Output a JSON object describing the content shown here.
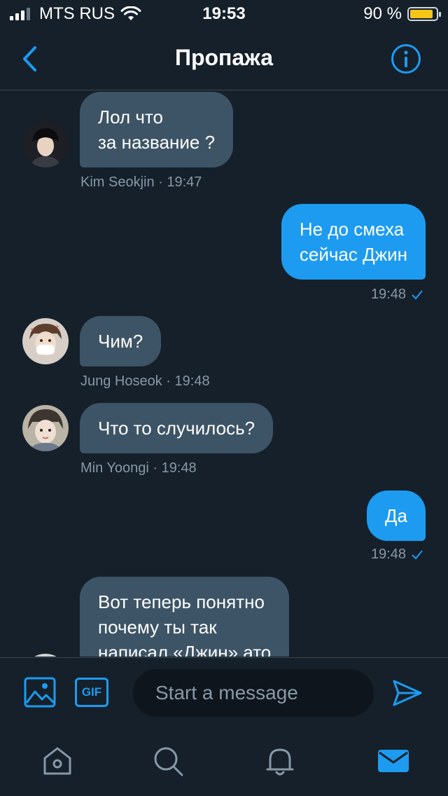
{
  "status_bar": {
    "carrier": "MTS RUS",
    "time": "19:53",
    "battery": "90 %",
    "battery_level": 0.9
  },
  "header": {
    "title": "Пропажа"
  },
  "messages": [
    {
      "direction": "in",
      "lines": [
        "Лол что",
        "за название ?"
      ],
      "meta": "Kim Seokjin · 19:47"
    },
    {
      "direction": "out",
      "lines": [
        "Не до смеха",
        "сейчас Джин"
      ],
      "time": "19:48"
    },
    {
      "direction": "in",
      "lines": [
        "Чим?"
      ],
      "meta": "Jung Hoseok · 19:48"
    },
    {
      "direction": "in",
      "lines": [
        "Что то случилось?"
      ],
      "meta": "Min Yoongi · 19:48"
    },
    {
      "direction": "out",
      "lines": [
        "Да"
      ],
      "time": "19:48"
    },
    {
      "direction": "in",
      "lines": [
        "Вот теперь понятно",
        "почему ты так",
        "написал «Джин» ато"
      ]
    }
  ],
  "composer": {
    "gif_label": "GIF",
    "placeholder": "Start a message"
  },
  "colors": {
    "background": "#15202b",
    "incoming_bubble": "#3d5466",
    "outgoing_bubble": "#1d9bf0",
    "accent": "#1d9bf0",
    "muted_text": "#8899a6"
  },
  "tabs": [
    {
      "icon": "home-icon",
      "active": false
    },
    {
      "icon": "search-icon",
      "active": false
    },
    {
      "icon": "bell-icon",
      "active": false
    },
    {
      "icon": "mail-icon",
      "active": true
    }
  ]
}
